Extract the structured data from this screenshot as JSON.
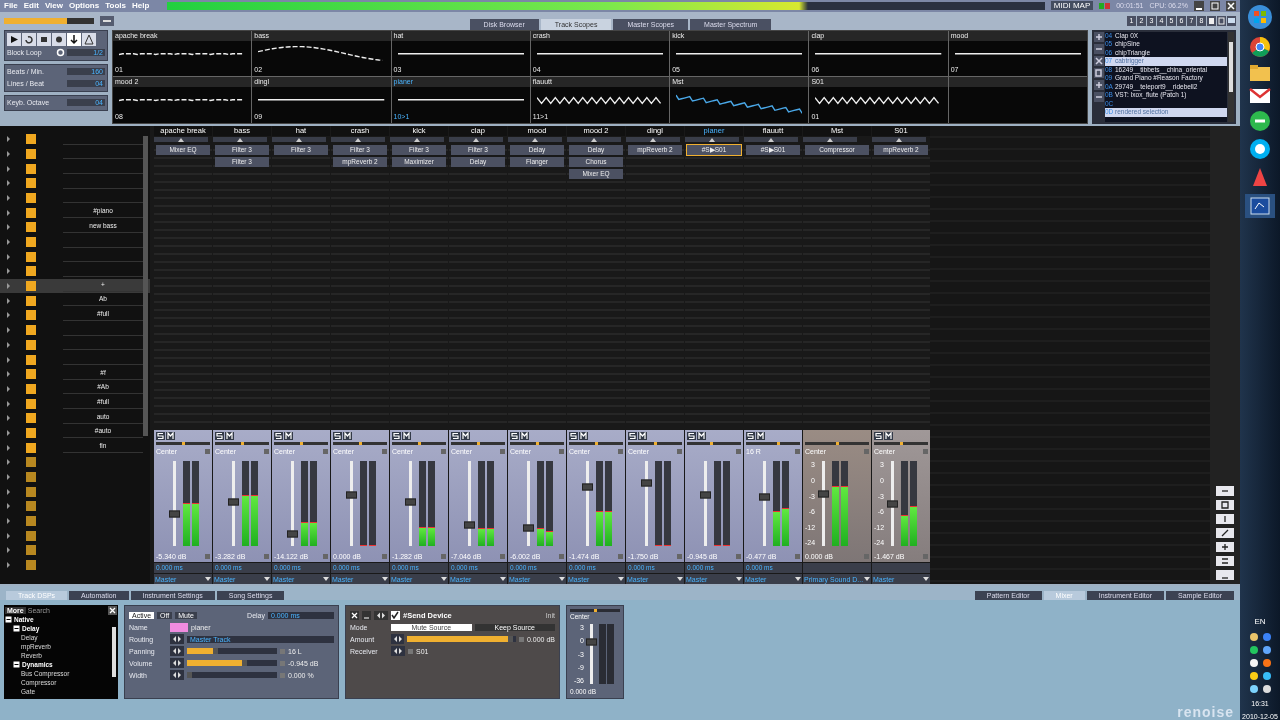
{
  "menu": [
    "File",
    "Edit",
    "View",
    "Options",
    "Tools",
    "Help"
  ],
  "master_volume": {
    "level": 0.7
  },
  "status": {
    "midi_map": "MIDI MAP",
    "time": "00:01:51",
    "cpu": "CPU: 06.2%"
  },
  "upper_tabs": [
    {
      "label": "Disk Browser",
      "selected": false
    },
    {
      "label": "Track Scopes",
      "selected": true
    },
    {
      "label": "Master Scopes",
      "selected": false
    },
    {
      "label": "Master Spectrum",
      "selected": false
    }
  ],
  "layout_buttons": [
    "1",
    "2",
    "3",
    "4",
    "5",
    "6",
    "7",
    "8"
  ],
  "transport": {
    "block_loop": {
      "label": "Block Loop",
      "value": "1/2"
    },
    "bpm": {
      "label": "Beats / Min.",
      "value": "160"
    },
    "lpb": {
      "label": "Lines / Beat",
      "value": "04"
    },
    "octave": {
      "label": "Keyb. Octave",
      "value": "04"
    }
  },
  "scopes": [
    {
      "name": "apache break",
      "number": "01",
      "selected": false,
      "kind": "flat"
    },
    {
      "name": "bass",
      "number": "02",
      "selected": false,
      "kind": "hump"
    },
    {
      "name": "hat",
      "number": "03",
      "selected": false,
      "kind": "line"
    },
    {
      "name": "crash",
      "number": "04",
      "selected": false,
      "kind": "line"
    },
    {
      "name": "kick",
      "number": "05",
      "selected": false,
      "kind": "line"
    },
    {
      "name": "clap",
      "number": "06",
      "selected": false,
      "kind": "line"
    },
    {
      "name": "mood",
      "number": "07",
      "selected": false,
      "kind": "line"
    },
    {
      "name": "mood 2",
      "number": "08",
      "selected": false,
      "kind": "flat"
    },
    {
      "name": "dingl",
      "number": "09",
      "selected": false,
      "kind": "line"
    },
    {
      "name": "pianer",
      "number": "10>1",
      "selected": true,
      "kind": "line"
    },
    {
      "name": "flauutt",
      "number": "11>1",
      "selected": false,
      "kind": "zig"
    },
    {
      "name": "Mst",
      "selected": false,
      "kind": "noise"
    },
    {
      "name": "S01",
      "number": "01",
      "selected": false,
      "kind": "zig"
    }
  ],
  "instruments": [
    {
      "index": "04",
      "name": "Clap 0X",
      "selected": false
    },
    {
      "index": "05",
      "name": "chipSine",
      "selected": false
    },
    {
      "index": "06",
      "name": "chipTriangle",
      "selected": false
    },
    {
      "index": "07",
      "name": "cabtrigger",
      "selected": true
    },
    {
      "index": "08",
      "name": "16249__tibbets__china_oriental",
      "selected": false
    },
    {
      "index": "09",
      "name": "Grand Piano #Reason Factory",
      "selected": false
    },
    {
      "index": "0A",
      "name": "29749__teleport9__ridebell2",
      "selected": false
    },
    {
      "index": "0B",
      "name": "VST: Ixox_flute (Patch 1)",
      "selected": false
    },
    {
      "index": "0C",
      "selected": false
    },
    {
      "index": "0D",
      "name": "rendered selection",
      "selected": true
    }
  ],
  "sequence": [
    {
      "kind": "pattern",
      "selected": false
    },
    {
      "kind": "pattern",
      "selected": false
    },
    {
      "kind": "pattern",
      "selected": false
    },
    {
      "kind": "pattern",
      "selected": false
    },
    {
      "kind": "pattern",
      "selected": false
    },
    {
      "kind": "pattern",
      "label": "#piano",
      "selected": false
    },
    {
      "kind": "pattern",
      "label": "new bass",
      "selected": false
    },
    {
      "kind": "pattern",
      "selected": false
    },
    {
      "kind": "pattern",
      "selected": false
    },
    {
      "kind": "pattern",
      "selected": false
    },
    {
      "kind": "pattern",
      "label": "+",
      "selected": true
    },
    {
      "kind": "pattern",
      "label": "Ab",
      "selected": false
    },
    {
      "kind": "pattern",
      "label": "#full",
      "selected": false
    },
    {
      "kind": "pattern",
      "selected": false
    },
    {
      "kind": "pattern",
      "selected": false
    },
    {
      "kind": "pattern",
      "selected": false
    },
    {
      "kind": "pattern",
      "label": "#f",
      "selected": false
    },
    {
      "kind": "pattern",
      "label": "#Ab",
      "selected": false
    },
    {
      "kind": "pattern",
      "label": "#full",
      "selected": false
    },
    {
      "kind": "pattern",
      "label": "auto",
      "selected": false
    },
    {
      "kind": "pattern",
      "label": "#auto",
      "selected": false
    },
    {
      "kind": "pattern",
      "label": "fin",
      "selected": false
    },
    {
      "kind": "empty",
      "selected": false
    },
    {
      "kind": "empty",
      "selected": false
    },
    {
      "kind": "empty",
      "selected": false
    },
    {
      "kind": "empty",
      "selected": false
    },
    {
      "kind": "empty",
      "selected": false
    },
    {
      "kind": "empty",
      "selected": false
    },
    {
      "kind": "empty",
      "selected": false
    },
    {
      "kind": "empty",
      "selected": false
    }
  ],
  "tracks": [
    {
      "kind": "track",
      "name": "apache break",
      "selected": false,
      "devices": [
        {
          "name": "Mixer EQ",
          "selected": false
        }
      ],
      "pan_slider": {
        "level": 0.5
      },
      "pan": "Center",
      "fader": {
        "level": 0.38
      },
      "meters": [
        {
          "level": 0.5
        },
        {
          "level": 0.5
        }
      ],
      "volume": "-5.340 dB",
      "delay": "0.000 ms",
      "output": "Master"
    },
    {
      "kind": "track",
      "name": "bass",
      "selected": false,
      "devices": [
        {
          "name": "Filter 3",
          "selected": false
        },
        {
          "name": "Filter 3",
          "selected": false
        }
      ],
      "pan_slider": {
        "level": 0.5
      },
      "pan": "Center",
      "fader": {
        "level": 0.52
      },
      "meters": [
        {
          "level": 0.59
        },
        {
          "level": 0.59
        }
      ],
      "volume": "-3.282 dB",
      "delay": "0.000 ms",
      "output": "Master"
    },
    {
      "kind": "track",
      "name": "hat",
      "selected": false,
      "devices": [
        {
          "name": "Filter 3",
          "selected": false
        }
      ],
      "pan_slider": {
        "level": 0.5
      },
      "pan": "Center",
      "fader": {
        "level": 0.15
      },
      "meters": [
        {
          "level": 0.27
        },
        {
          "level": 0.27
        }
      ],
      "volume": "-14.122 dB",
      "delay": "0.000 ms",
      "output": "Master"
    },
    {
      "kind": "track",
      "name": "crash",
      "selected": false,
      "devices": [
        {
          "name": "Filter 3",
          "selected": false
        },
        {
          "name": "mpReverb 2",
          "selected": false
        }
      ],
      "pan_slider": {
        "level": 0.5
      },
      "pan": "Center",
      "fader": {
        "level": 0.6
      },
      "meters": [
        {
          "level": 0
        },
        {
          "level": 0
        }
      ],
      "volume": "0.000 dB",
      "delay": "0.000 ms",
      "output": "Master"
    },
    {
      "kind": "track",
      "name": "kick",
      "selected": false,
      "devices": [
        {
          "name": "Filter 3",
          "selected": false
        },
        {
          "name": "Maximizer",
          "selected": false
        }
      ],
      "pan_slider": {
        "level": 0.5
      },
      "pan": "Center",
      "fader": {
        "level": 0.52
      },
      "meters": [
        {
          "level": 0.22
        },
        {
          "level": 0.22
        }
      ],
      "volume": "-1.282 dB",
      "delay": "0.000 ms",
      "output": "Master"
    },
    {
      "kind": "track",
      "name": "clap",
      "selected": false,
      "devices": [
        {
          "name": "Filter 3",
          "selected": false
        },
        {
          "name": "Delay",
          "selected": false
        }
      ],
      "pan_slider": {
        "level": 0.5
      },
      "pan": "Center",
      "fader": {
        "level": 0.25
      },
      "meters": [
        {
          "level": 0.2
        },
        {
          "level": 0.2
        }
      ],
      "volume": "-7.046 dB",
      "delay": "0.000 ms",
      "output": "Master"
    },
    {
      "kind": "track",
      "name": "mood",
      "selected": false,
      "devices": [
        {
          "name": "Delay",
          "selected": false
        },
        {
          "name": "Flanger",
          "selected": false
        }
      ],
      "pan_slider": {
        "level": 0.5
      },
      "pan": "Center",
      "fader": {
        "level": 0.22
      },
      "meters": [
        {
          "level": 0.2
        },
        {
          "level": 0.17
        }
      ],
      "volume": "-6.002 dB",
      "delay": "0.000 ms",
      "output": "Master"
    },
    {
      "kind": "track",
      "name": "mood 2",
      "selected": false,
      "devices": [
        {
          "name": "Delay",
          "selected": false
        },
        {
          "name": "Chorus",
          "selected": false
        },
        {
          "name": "Mixer EQ",
          "selected": false
        }
      ],
      "pan_slider": {
        "level": 0.5
      },
      "pan": "Center",
      "fader": {
        "level": 0.7
      },
      "meters": [
        {
          "level": 0.4
        },
        {
          "level": 0.4
        }
      ],
      "volume": "-1.474 dB",
      "delay": "0.000 ms",
      "output": "Master"
    },
    {
      "kind": "track",
      "name": "dingl",
      "selected": false,
      "devices": [
        {
          "name": "mpReverb 2",
          "selected": false
        }
      ],
      "pan_slider": {
        "level": 0.5
      },
      "pan": "Center",
      "fader": {
        "level": 0.74
      },
      "meters": [
        {
          "level": 0
        },
        {
          "level": 0
        }
      ],
      "volume": "-1.750 dB",
      "delay": "0.000 ms",
      "output": "Master"
    },
    {
      "kind": "track",
      "name": "pianer",
      "selected": true,
      "devices": [
        {
          "name": "#S▶S01",
          "selected": true
        }
      ],
      "pan_slider": {
        "level": 0.45
      },
      "fader": {
        "level": 0.6
      },
      "meters": [
        {
          "level": 0
        },
        {
          "level": 0
        }
      ],
      "volume": "-0.945 dB",
      "delay": "0.000 ms",
      "output": "Master"
    },
    {
      "kind": "track",
      "name": "flauutt",
      "selected": false,
      "devices": [
        {
          "name": "#S▶S01",
          "selected": false
        }
      ],
      "pan_slider": {
        "level": 0.6
      },
      "pan": "16 R",
      "fader": {
        "level": 0.58
      },
      "meters": [
        {
          "level": 0.4
        },
        {
          "level": 0.44
        }
      ],
      "volume": "-0.477 dB",
      "delay": "0.000 ms",
      "output": "Master"
    },
    {
      "kind": "master",
      "name": "Mst",
      "selected": false,
      "devices": [
        {
          "name": "Compressor",
          "selected": false
        }
      ],
      "pan_slider": {
        "level": 0.5
      },
      "pan": "Center",
      "scale": [
        "3",
        "0",
        "-3",
        "-6",
        "-12",
        "-24"
      ],
      "fader": {
        "level": 0.62
      },
      "meters": [
        {
          "level": 0.7
        },
        {
          "level": 0.7
        }
      ],
      "volume": "0.000 dB",
      "output": "Primary Sound D..."
    },
    {
      "kind": "send",
      "name": "S01",
      "selected": false,
      "devices": [
        {
          "name": "mpReverb 2",
          "selected": false
        }
      ],
      "pan_slider": {
        "level": 0.5
      },
      "pan": "Center",
      "scale": [
        "3",
        "0",
        "-3",
        "-6",
        "-12",
        "-24"
      ],
      "fader": {
        "level": 0.5
      },
      "meters": [
        {
          "level": 0.36
        },
        {
          "level": 0.46
        }
      ],
      "volume": "-1.467 dB",
      "output": "Master"
    }
  ],
  "lower_tabs": [
    {
      "label": "Track DSPs",
      "selected": true
    },
    {
      "label": "Automation",
      "selected": false
    },
    {
      "label": "Instrument Settings",
      "selected": false
    },
    {
      "label": "Song Settings",
      "selected": false
    }
  ],
  "view_tabs": [
    {
      "label": "Pattern Editor",
      "selected": false
    },
    {
      "label": "Mixer",
      "selected": true
    },
    {
      "label": "Instrument Editor",
      "selected": false
    },
    {
      "label": "Sample Editor",
      "selected": false
    }
  ],
  "browser": {
    "more": "More",
    "search": {
      "placeholder": "Search"
    },
    "tree": [
      {
        "label": "Native",
        "expanded": true,
        "children": [
          {
            "label": "Delay",
            "expanded": true,
            "children": [
              {
                "label": "Delay"
              },
              {
                "label": "mpReverb"
              },
              {
                "label": "Reverb"
              }
            ]
          },
          {
            "label": "Dynamics",
            "expanded": true,
            "children": [
              {
                "label": "Bus Compressor"
              },
              {
                "label": "Compressor"
              },
              {
                "label": "Gate"
              }
            ]
          }
        ]
      }
    ]
  },
  "track_panel": {
    "states": [
      {
        "label": "Active",
        "selected": true
      },
      {
        "label": "Off",
        "selected": false
      },
      {
        "label": "Mute",
        "selected": false
      }
    ],
    "delay_label": "Delay",
    "delay": "0.000 ms",
    "name_label": "Name",
    "color": "#f08ce0",
    "name": "pianer",
    "routing_label": "Routing",
    "routing": "Master Track",
    "sliders": [
      {
        "label": "Panning",
        "level": 0.3,
        "reading": "16 L"
      },
      {
        "label": "Volume",
        "level": 0.65,
        "reading": "-0.945 dB"
      },
      {
        "label": "Width",
        "level": 0,
        "reading": "0.000 %"
      }
    ]
  },
  "send_device": {
    "enabled": true,
    "title": "#Send Device",
    "preset": "Init",
    "mode_label": "Mode",
    "modes": [
      {
        "label": "Mute Source",
        "selected": true
      },
      {
        "label": "Keep Source",
        "selected": false
      }
    ],
    "amount_label": "Amount",
    "amount": {
      "level": 0.97
    },
    "amount_reading": "0.000 dB",
    "receiver_label": "Receiver",
    "receiver": "S01"
  },
  "master_meter": {
    "pan": "Center",
    "pan_slider": {
      "level": 0.5
    },
    "fader": {
      "level": 0.7
    },
    "scale": [
      "3",
      "0",
      "-3",
      "-9",
      "-36"
    ],
    "volume": "0.000 dB"
  },
  "logo": "renoise",
  "taskbar": {
    "language": "EN",
    "time": "16:31",
    "date": "2010-12-05"
  }
}
